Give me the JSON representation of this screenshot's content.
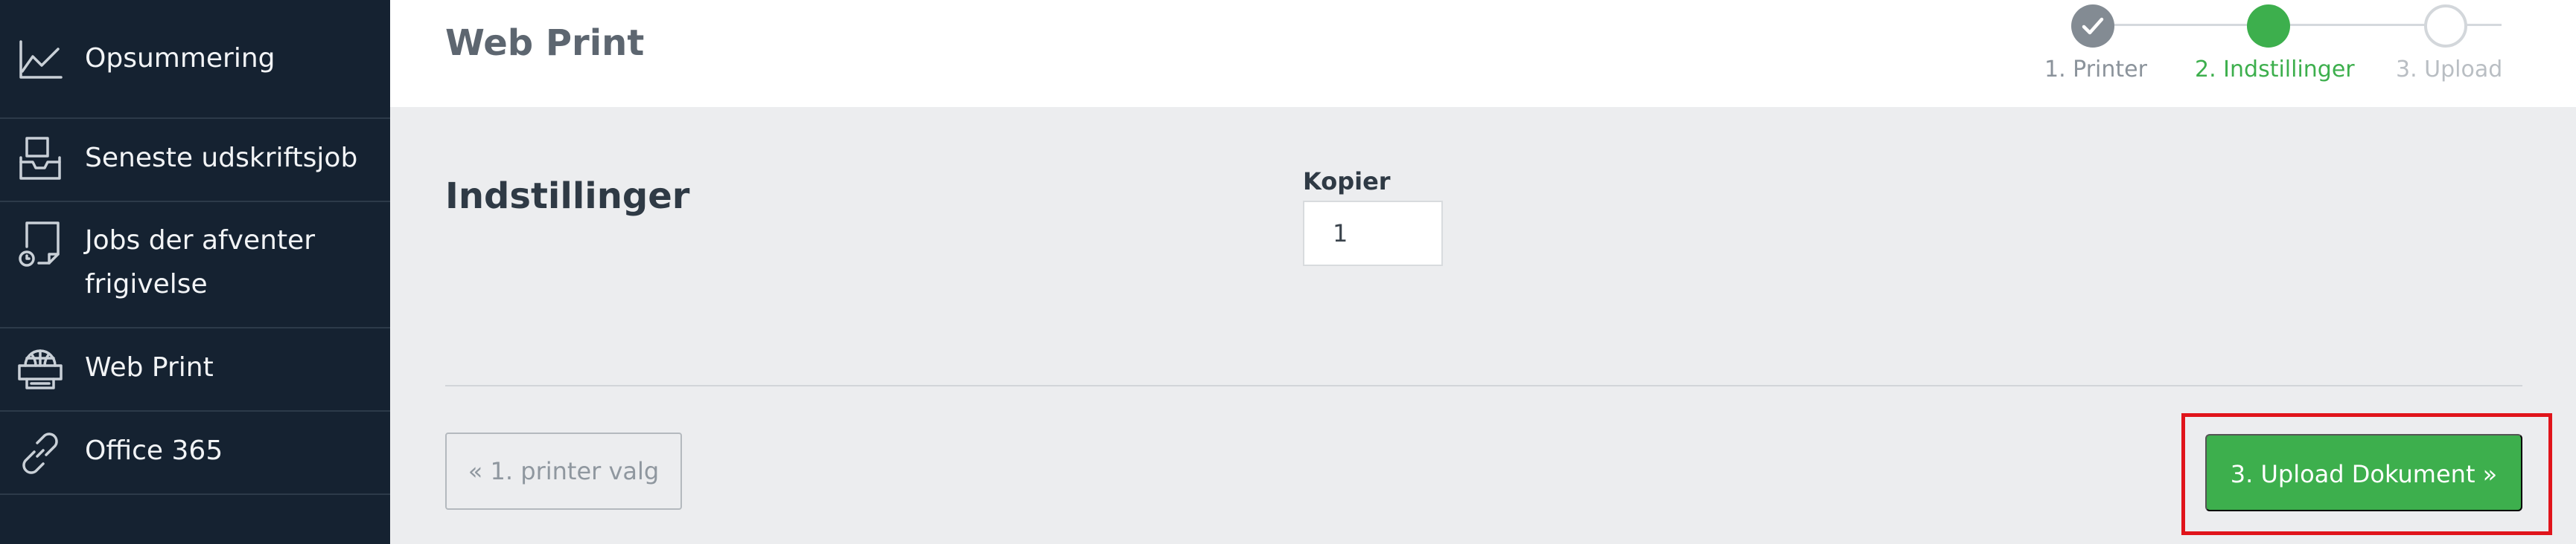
{
  "sidebar": {
    "items": [
      {
        "label": "Opsummering",
        "icon": "chart-line-icon"
      },
      {
        "label": "Seneste udskriftsjob",
        "icon": "inbox-tray-icon"
      },
      {
        "label_line1": "Jobs der afventer",
        "label_line2": "frigivelse",
        "icon": "document-pending-icon"
      },
      {
        "label": "Web Print",
        "icon": "globe-printer-icon"
      },
      {
        "label": "Office 365",
        "icon": "link-icon"
      }
    ]
  },
  "header": {
    "title": "Web Print",
    "steps": [
      {
        "label": "1. Printer",
        "state": "done",
        "icon": "check-icon"
      },
      {
        "label": "2. Indstillinger",
        "state": "active"
      },
      {
        "label": "3. Upload",
        "state": "todo"
      }
    ]
  },
  "main": {
    "section_title": "Indstillinger",
    "copies_label": "Kopier",
    "copies_value": "1"
  },
  "footer": {
    "back_label": "« 1. printer valg",
    "next_label": "3. Upload Dokument »"
  },
  "colors": {
    "sidebar_bg": "#152231",
    "accent_green": "#3daf4d",
    "step_done_gray": "#838b93",
    "highlight_red": "#e0141b",
    "content_bg": "#ecedef"
  }
}
